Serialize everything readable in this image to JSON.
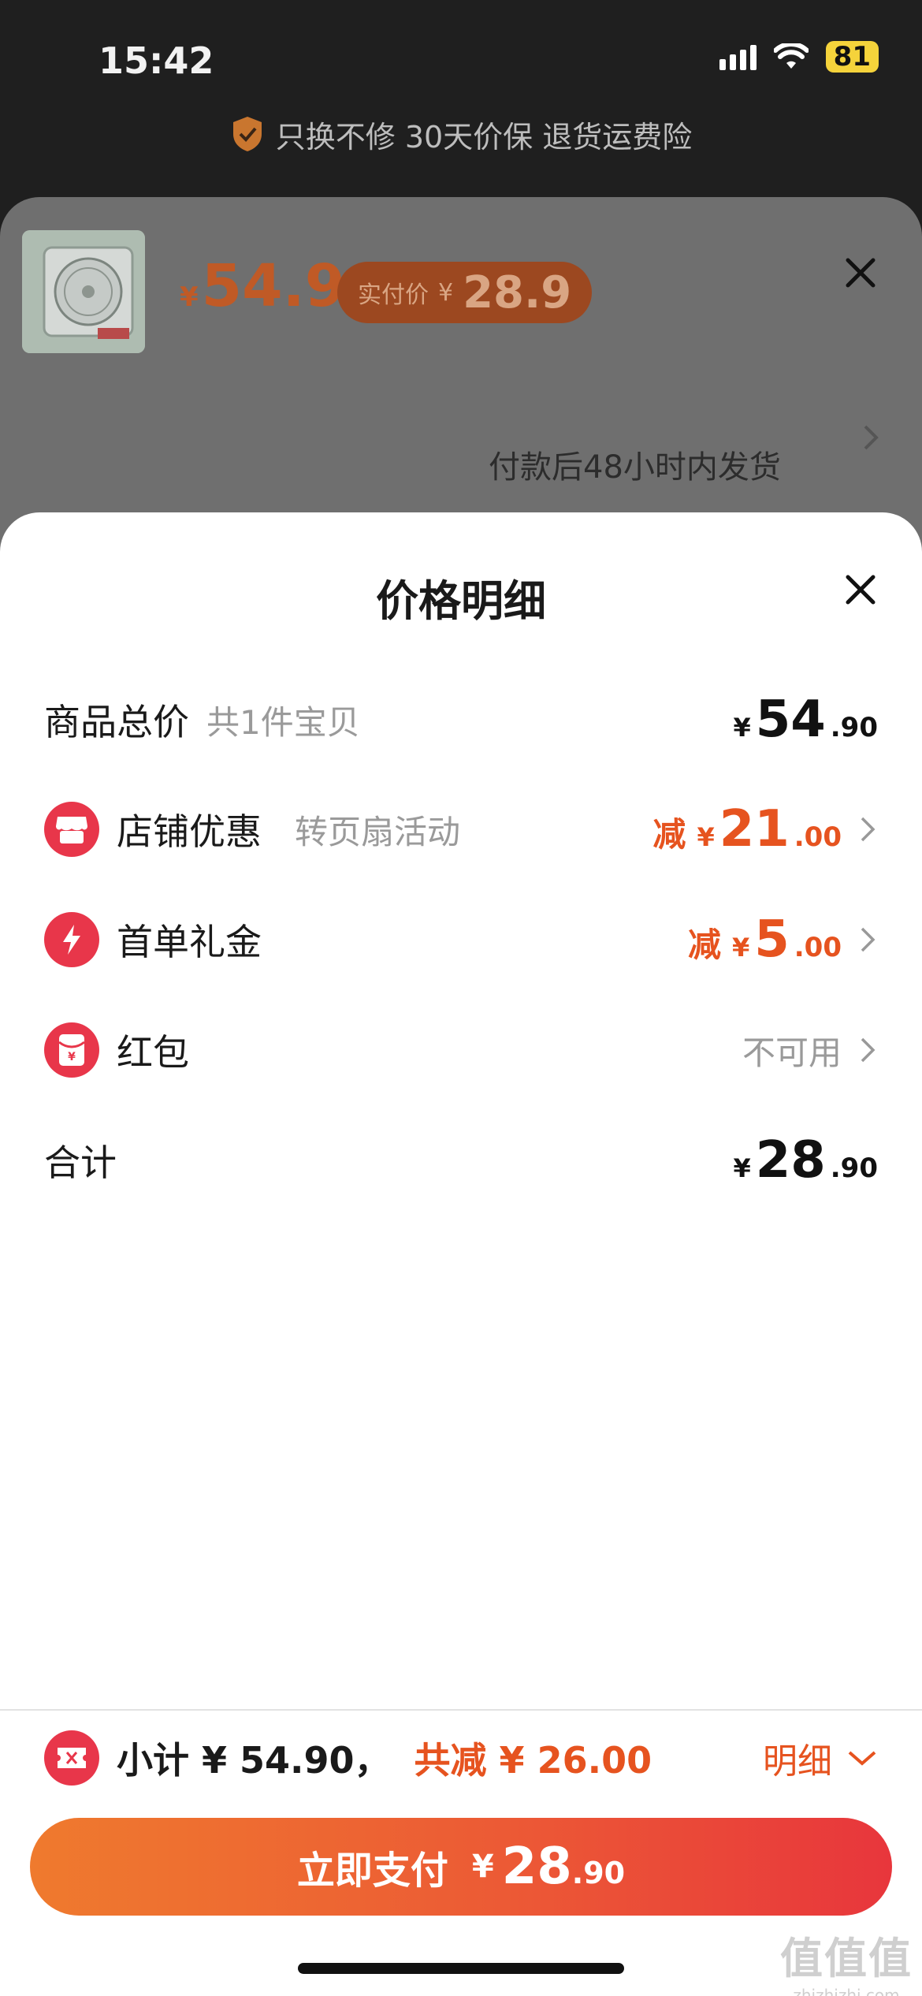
{
  "status_bar": {
    "time": "15:42",
    "battery": "81"
  },
  "guarantee": {
    "text": "只换不修 30天价保 退货运费险"
  },
  "product": {
    "price_yen": "¥",
    "price": "54.9",
    "paid_label": "实付价",
    "paid_yen": "¥",
    "paid_price": "28.9",
    "shipping_text": "付款后48小时内发货"
  },
  "detail": {
    "title": "价格明细",
    "rows": [
      {
        "label": "商品总价",
        "sub": "共1件宝贝",
        "prefix": "",
        "yen": "¥",
        "int": "54",
        "dec": ".90"
      },
      {
        "label": "店铺优惠",
        "sub": "转页扇活动",
        "prefix": "减",
        "yen": "¥",
        "int": "21",
        "dec": ".00",
        "icon": "shop-icon"
      },
      {
        "label": "首单礼金",
        "sub": "",
        "prefix": "减",
        "yen": "¥",
        "int": "5",
        "dec": ".00",
        "icon": "lightning-icon"
      },
      {
        "label": "红包",
        "sub": "",
        "value": "不可用",
        "icon": "red-envelope-icon"
      },
      {
        "label": "合计",
        "sub": "",
        "yen": "¥",
        "int": "28",
        "dec": ".90"
      }
    ]
  },
  "summary": {
    "subtotal": "小计 ¥ 54.90，",
    "saved": "共减 ¥ 26.00",
    "details_link": "明细"
  },
  "pay_button": {
    "label": "立即支付",
    "yen": "¥",
    "int": "28",
    "dec": ".90"
  },
  "watermark": {
    "main": "值值值",
    "sub": "zhizhizhi.com"
  },
  "colors": {
    "accent": "#e6531f",
    "icon_red": "#e8364a",
    "button_start": "#ef7a2e",
    "button_end": "#e8363c"
  }
}
